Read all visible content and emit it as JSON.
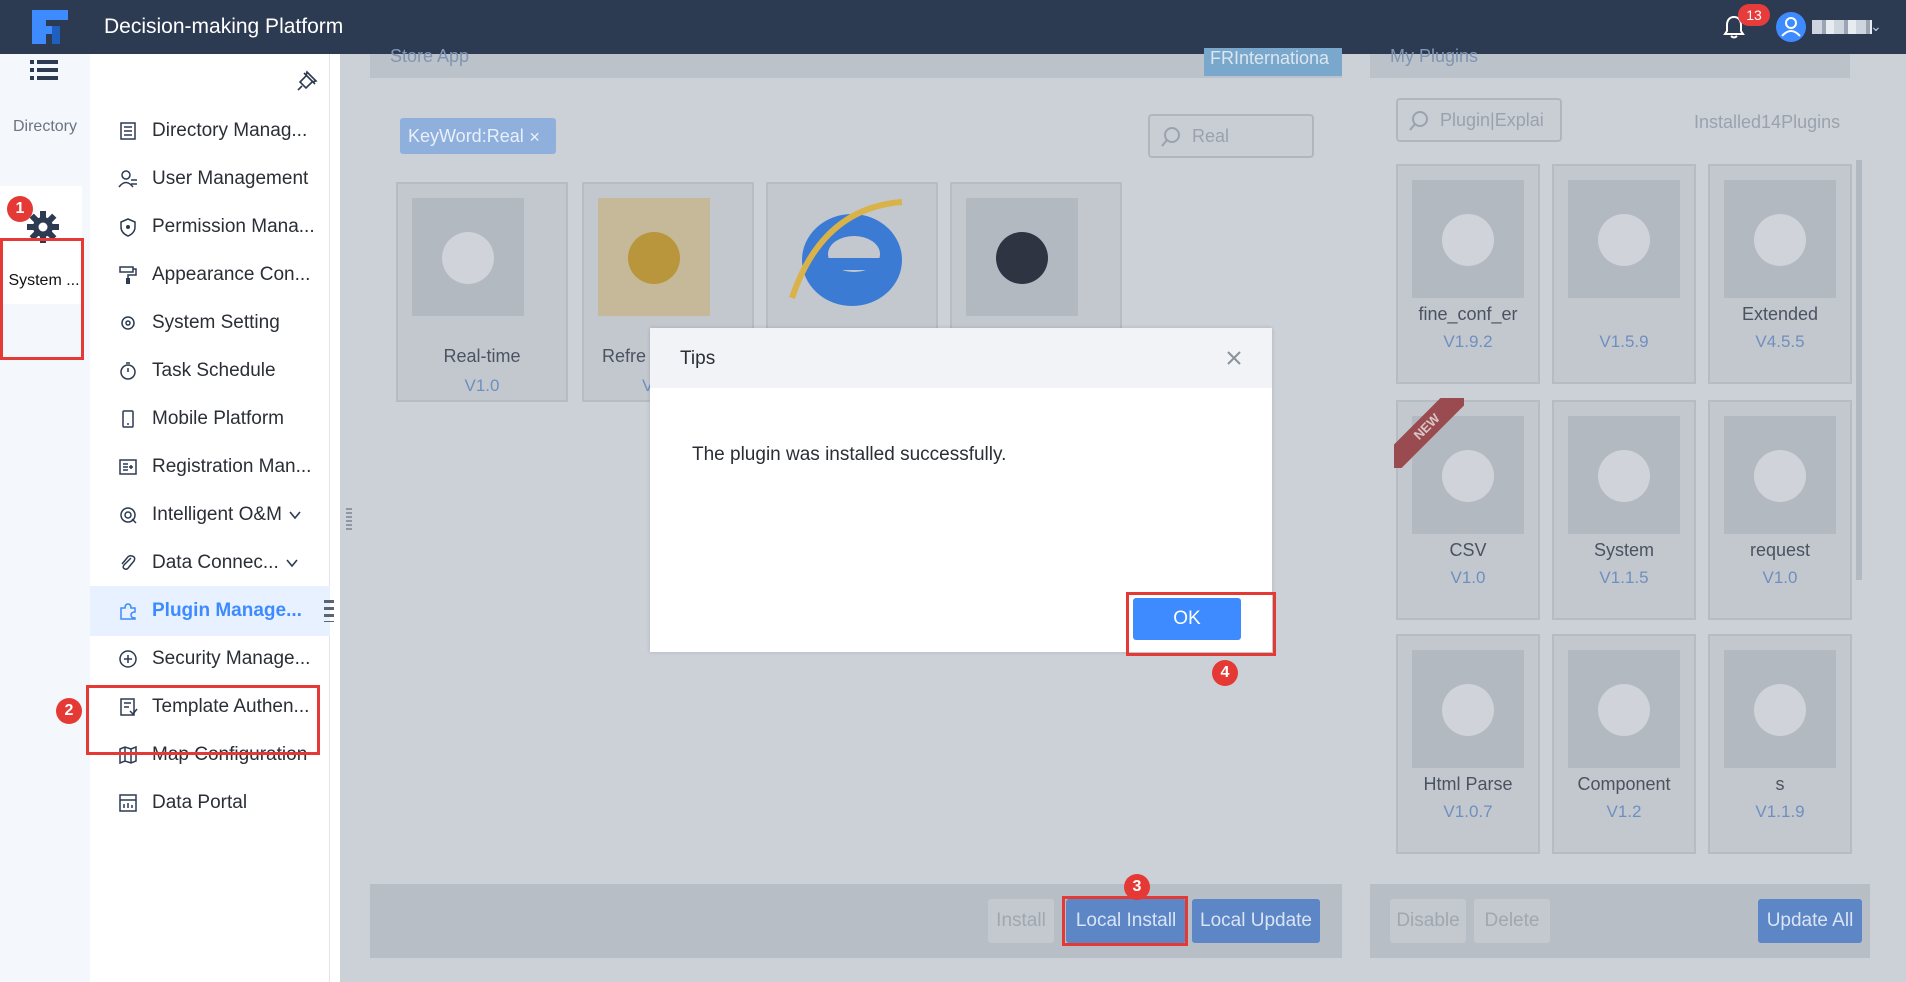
{
  "header": {
    "app_title": "Decision-making Platform",
    "notification_count": "13",
    "logo_icon": "fine-logo-icon"
  },
  "rail": {
    "directory_label": "Directory",
    "system_label": "System ..."
  },
  "menu": {
    "items": [
      {
        "label": "Directory Manag...",
        "icon": "directory-icon"
      },
      {
        "label": "User Management",
        "icon": "user-icon"
      },
      {
        "label": "Permission Mana...",
        "icon": "shield-icon"
      },
      {
        "label": "Appearance Con...",
        "icon": "paint-roller-icon"
      },
      {
        "label": "System Setting",
        "icon": "gear-icon"
      },
      {
        "label": "Task Schedule",
        "icon": "stopwatch-icon"
      },
      {
        "label": "Mobile Platform",
        "icon": "phone-icon"
      },
      {
        "label": "Registration Man...",
        "icon": "registration-icon"
      },
      {
        "label": "Intelligent O&M",
        "icon": "om-icon"
      },
      {
        "label": "Data Connec...",
        "icon": "paperclip-icon"
      },
      {
        "label": "Plugin Manage...",
        "icon": "puzzle-icon"
      },
      {
        "label": "Security Manage...",
        "icon": "security-icon"
      },
      {
        "label": "Template Authen...",
        "icon": "template-icon"
      },
      {
        "label": "Map Configuration",
        "icon": "map-icon"
      },
      {
        "label": "Data Portal",
        "icon": "portal-icon"
      }
    ]
  },
  "store": {
    "title": "Store App",
    "tab_label": "FRInternationa",
    "keyword_tag": "KeyWord:Real",
    "search_value": "Real",
    "plugins": [
      {
        "name": "Real-time",
        "version": "V1.0"
      },
      {
        "name": "Refre",
        "version": "V"
      },
      {
        "name": "",
        "version": ""
      },
      {
        "name": "",
        "version": ""
      }
    ],
    "buttons": {
      "install": "Install",
      "local_install": "Local Install",
      "local_update": "Local Update"
    }
  },
  "my_plugins": {
    "title": "My Plugins",
    "search_placeholder": "Plugin|Explai",
    "installed_count": "Installed14Plugins",
    "plugins": [
      {
        "name": "fine_conf_er",
        "version": "V1.9.2"
      },
      {
        "name": "",
        "version": "V1.5.9"
      },
      {
        "name": "Extended",
        "version": "V4.5.5"
      },
      {
        "name": "CSV",
        "version": "V1.0"
      },
      {
        "name": "System",
        "version": "V1.1.5"
      },
      {
        "name": "request",
        "version": "V1.0"
      },
      {
        "name": "Html Parse",
        "version": "V1.0.7"
      },
      {
        "name": "Component",
        "version": "V1.2"
      },
      {
        "name": "s",
        "version": "V1.1.9"
      }
    ],
    "new_badge": "NEW",
    "buttons": {
      "disable": "Disable",
      "delete": "Delete",
      "update_all": "Update All"
    }
  },
  "dialog": {
    "title": "Tips",
    "message": "The plugin was installed successfully.",
    "ok_label": "OK"
  },
  "callouts": [
    "1",
    "2",
    "3",
    "4"
  ],
  "colors": {
    "header_bg": "#2c3a52",
    "accent": "#3d8bff",
    "callout": "#e53935"
  }
}
